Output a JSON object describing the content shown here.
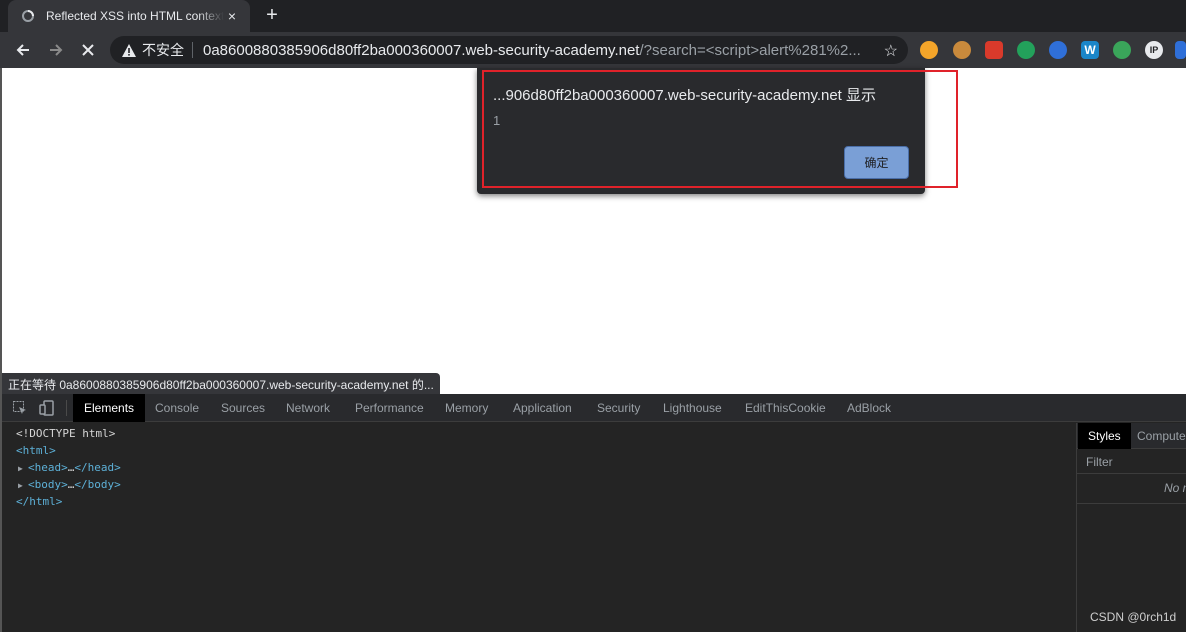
{
  "browser": {
    "tab": {
      "title": "Reflected XSS into HTML context with nothing encoded",
      "close_icon": "×"
    },
    "new_tab_icon": "+",
    "omnibox": {
      "insecure_label": "不安全",
      "host": "0a8600880385906d80ff2ba000360007.web-security-academy.net",
      "path": "/?search=<script>alert%281%2..."
    },
    "icons": [
      "back-arrow-icon",
      "forward-arrow-icon",
      "stop-icon",
      "warning-icon",
      "star-icon",
      "extension-icons"
    ]
  },
  "dialog": {
    "title": "...906d80ff2ba000360007.web-security-academy.net 显示",
    "message": "1",
    "ok_label": "确定",
    "highlight_color": "#e0222a"
  },
  "status_bar": {
    "text": "正在等待 0a8600880385906d80ff2ba000360007.web-security-academy.net 的..."
  },
  "devtools": {
    "tabs": [
      "Elements",
      "Console",
      "Sources",
      "Network",
      "Performance",
      "Memory",
      "Application",
      "Security",
      "Lighthouse",
      "EditThisCookie",
      "AdBlock"
    ],
    "active_tab": "Elements",
    "dom": {
      "doctype": "<!DOCTYPE html>",
      "html_open": "<html>",
      "head": "<head>",
      "head_close": "</head>",
      "body": "<body>",
      "body_close": "</body>",
      "ellipsis": "…",
      "html_close": "</html>"
    },
    "side_tabs": [
      "Styles",
      "Computed"
    ],
    "filter_placeholder": "Filter",
    "no_match": "No m"
  },
  "watermark": "CSDN @0rch1d"
}
